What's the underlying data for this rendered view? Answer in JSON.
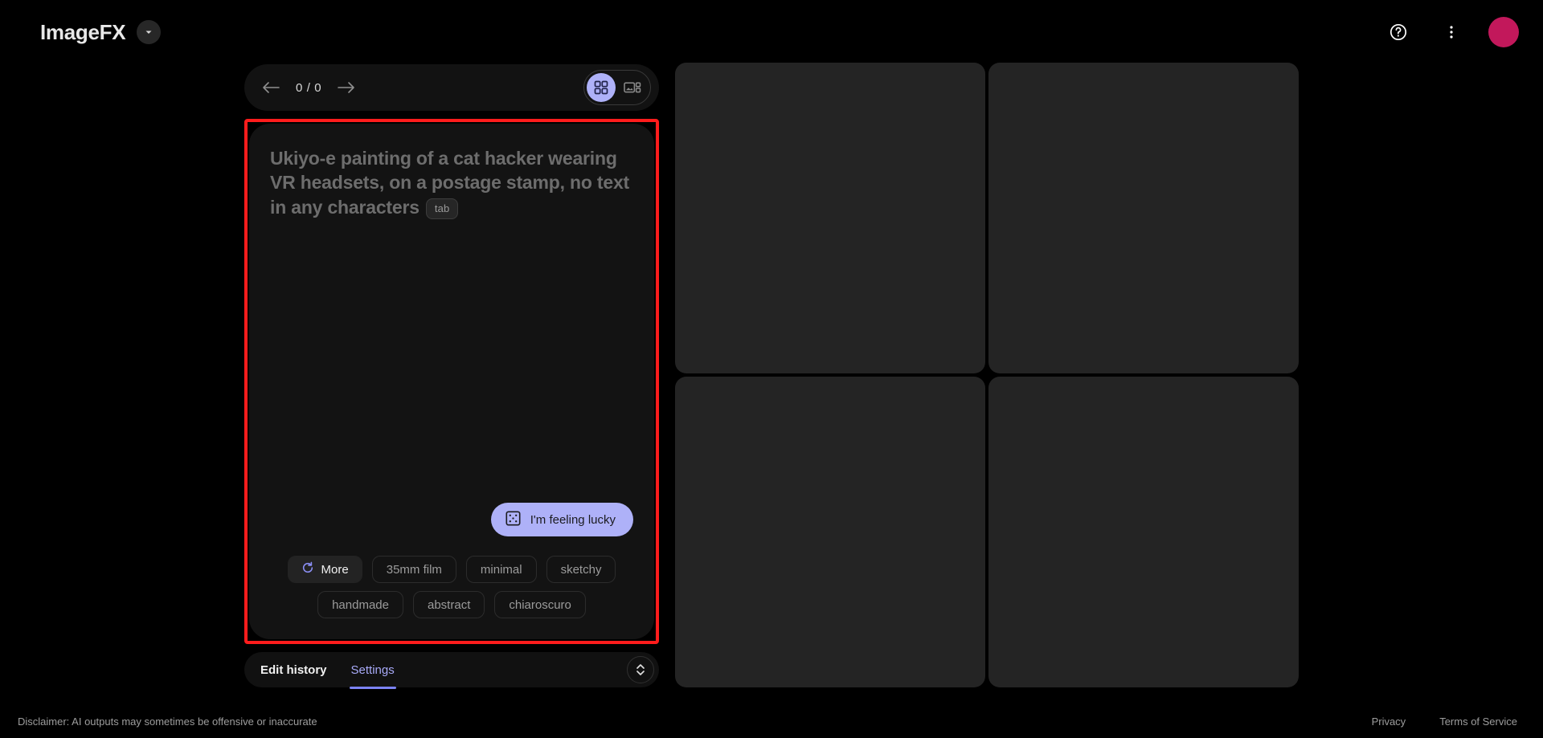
{
  "app": {
    "title": "ImageFX",
    "brand_caret_icon": "chevron-down-icon"
  },
  "topbar": {
    "help_icon": "help-circle-icon",
    "menu_icon": "more-vertical-icon",
    "avatar_color": "#c2185b",
    "avatar_name": "user-avatar"
  },
  "nav": {
    "prev_icon": "arrow-left-icon",
    "next_icon": "arrow-right-icon",
    "counter": "0 / 0",
    "views": [
      {
        "name": "grid-view",
        "icon": "grid-icon",
        "active": true
      },
      {
        "name": "detail-view",
        "icon": "image-detail-icon",
        "active": false
      }
    ],
    "active_view_color": "#aeb1f8"
  },
  "prompt": {
    "text": "Ukiyo-e painting of a cat hacker wearing VR headsets, on a postage stamp, no text in any characters",
    "badge": "tab",
    "highlight_color": "#ff1c1c"
  },
  "lucky": {
    "label": "I'm feeling lucky",
    "icon": "dice-icon",
    "bg_color": "#aeb1f8"
  },
  "chips": [
    {
      "label": "More",
      "icon": "refresh-icon",
      "primary": true
    },
    {
      "label": "35mm film",
      "primary": false
    },
    {
      "label": "minimal",
      "primary": false
    },
    {
      "label": "sketchy",
      "primary": false
    },
    {
      "label": "handmade",
      "primary": false
    },
    {
      "label": "abstract",
      "primary": false
    },
    {
      "label": "chiaroscuro",
      "primary": false
    }
  ],
  "tabs": {
    "items": [
      {
        "label": "Edit history",
        "active": false
      },
      {
        "label": "Settings",
        "active": true
      }
    ],
    "expand_icon": "chevron-up-down-icon",
    "active_color": "#a8aaf8"
  },
  "grid": {
    "cells": [
      {
        "name": "image-placeholder-1"
      },
      {
        "name": "image-placeholder-2"
      },
      {
        "name": "image-placeholder-3"
      },
      {
        "name": "image-placeholder-4"
      }
    ],
    "cell_color": "#242424"
  },
  "footer": {
    "disclaimer": "Disclaimer: AI outputs may sometimes be offensive or inaccurate",
    "links": [
      {
        "label": "Privacy"
      },
      {
        "label": "Terms of Service"
      }
    ]
  }
}
